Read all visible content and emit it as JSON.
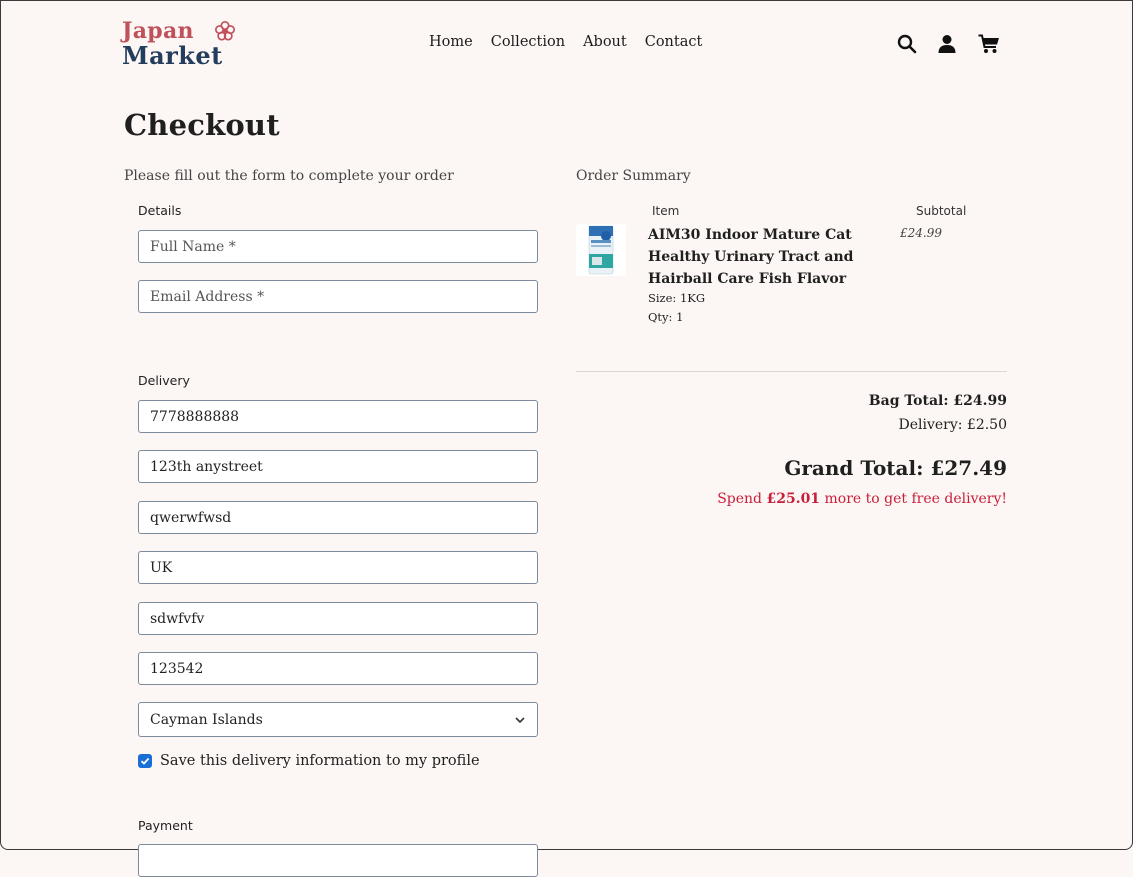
{
  "brand": {
    "line1": "Japan",
    "line2": "Market"
  },
  "nav": {
    "home": "Home",
    "collection": "Collection",
    "about": "About",
    "contact": "Contact"
  },
  "header_icons": [
    "search-icon",
    "account-icon",
    "cart-icon"
  ],
  "page": {
    "title": "Checkout",
    "subtitle": "Please fill out the form to complete your order"
  },
  "form": {
    "details_label": "Details",
    "full_name_placeholder": "Full Name *",
    "email_placeholder": "Email Address *",
    "delivery_label": "Delivery",
    "phone": "7778888888",
    "street1": "123th anystreet",
    "street2": "qwerwfwsd",
    "town": "UK",
    "county": "sdwfvfv",
    "postcode": "123542",
    "country": "Cayman Islands",
    "save_info_label": "Save this delivery information to my profile",
    "save_info_checked": true,
    "payment_label": "Payment"
  },
  "summary": {
    "heading": "Order Summary",
    "col_item": "Item",
    "col_subtotal": "Subtotal",
    "item": {
      "name": "AIM30 Indoor Mature Cat Healthy Urinary Tract and Hairball Care Fish Flavor",
      "size": "Size: 1KG",
      "qty": "Qty: 1",
      "price": "£24.99"
    },
    "bag_total": "Bag Total: £24.99",
    "delivery": "Delivery: £2.50",
    "grand_total": "Grand Total: £27.49",
    "free_prefix": "Spend ",
    "free_amount": "£25.01",
    "free_suffix": " more to get free delivery!"
  },
  "colors": {
    "accent_red": "#c81e3a",
    "logo_red": "#c0505a",
    "logo_navy": "#233d5c",
    "checkbox_blue": "#1a6fd6"
  }
}
